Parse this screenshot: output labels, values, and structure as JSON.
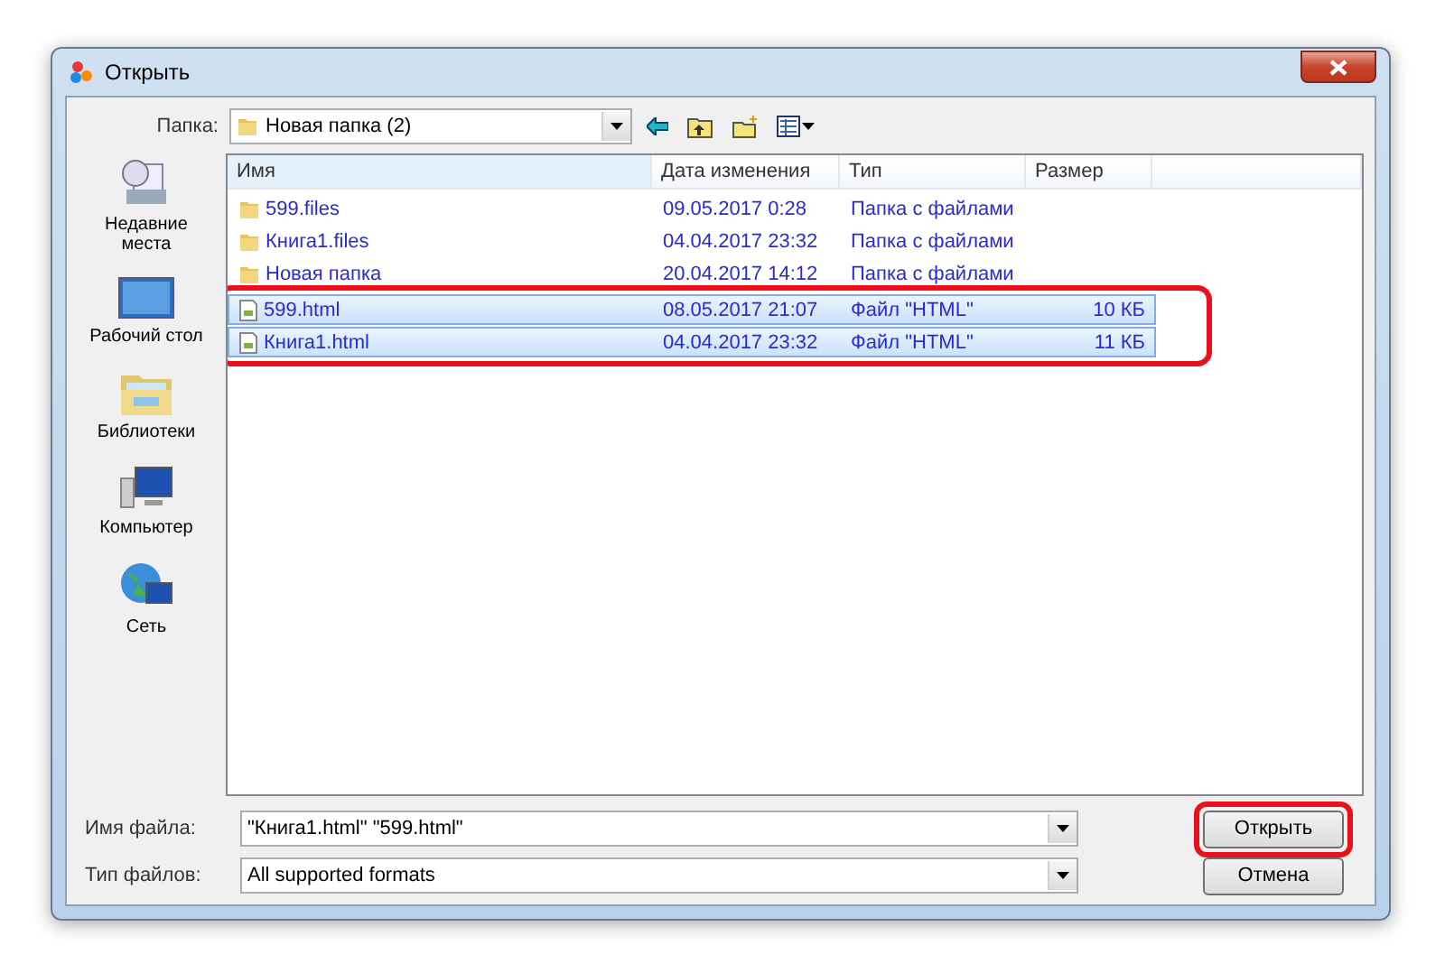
{
  "window": {
    "title": "Открыть"
  },
  "folder": {
    "label": "Папка:",
    "value": "Новая папка (2)"
  },
  "places": [
    {
      "kind": "recent",
      "label": "Недавние места"
    },
    {
      "kind": "desktop",
      "label": "Рабочий стол"
    },
    {
      "kind": "libraries",
      "label": "Библиотеки"
    },
    {
      "kind": "computer",
      "label": "Компьютер"
    },
    {
      "kind": "network",
      "label": "Сеть"
    }
  ],
  "table": {
    "columns": [
      "Имя",
      "Дата изменения",
      "Тип",
      "Размер"
    ],
    "rows": [
      {
        "kind": "folder",
        "name": "599.files",
        "date": "09.05.2017 0:28",
        "type": "Папка с файлами",
        "size": "",
        "selected": false,
        "circled": false
      },
      {
        "kind": "folder",
        "name": "Книга1.files",
        "date": "04.04.2017 23:32",
        "type": "Папка с файлами",
        "size": "",
        "selected": false,
        "circled": false
      },
      {
        "kind": "folder",
        "name": "Новая папка",
        "date": "20.04.2017 14:12",
        "type": "Папка с файлами",
        "size": "",
        "selected": false,
        "circled": false
      },
      {
        "kind": "file",
        "name": "599.html",
        "date": "08.05.2017 21:07",
        "type": "Файл \"HTML\"",
        "size": "10 КБ",
        "selected": true,
        "circled": true
      },
      {
        "kind": "file",
        "name": "Книга1.html",
        "date": "04.04.2017 23:32",
        "type": "Файл \"HTML\"",
        "size": "11 КБ",
        "selected": true,
        "circled": true
      }
    ]
  },
  "filename": {
    "label": "Имя файла:",
    "value": "\"Книга1.html\" \"599.html\""
  },
  "filetype": {
    "label": "Тип файлов:",
    "value": "All supported formats"
  },
  "buttons": [
    {
      "label": "Открыть",
      "circled": true
    },
    {
      "label": "Отмена",
      "circled": false
    }
  ]
}
